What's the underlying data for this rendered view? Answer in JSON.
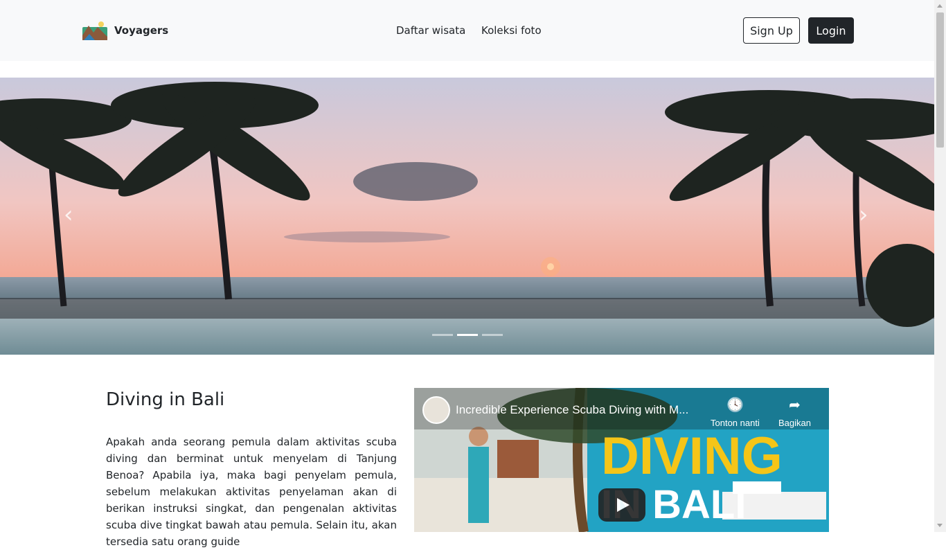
{
  "navbar": {
    "brand": "Voyagers",
    "links": [
      "Daftar wisata",
      "Koleksi foto"
    ],
    "signup_label": "Sign Up",
    "login_label": "Login"
  },
  "carousel": {
    "indicators": 3,
    "active_index": 1,
    "prev_icon": "chevron-left-icon",
    "next_icon": "chevron-right-icon"
  },
  "article": {
    "title": "Diving in Bali",
    "body": "Apakah anda seorang pemula dalam aktivitas scuba diving dan berminat untuk menyelam di Tanjung Benoa? Apabila iya, maka bagi penyelam pemula, sebelum melakukan aktivitas penyelaman akan di berikan instruksi singkat, dan pengenalan aktivitas scuba dive tingkat bawah atau pemula. Selain itu, akan tersedia satu orang guide"
  },
  "video": {
    "title": "Incredible Experience Scuba Diving with M...",
    "watch_later": "Tonton nanti",
    "share": "Bagikan",
    "thumb_line1": "DIVING",
    "thumb_line2": "IN BALI"
  },
  "colors": {
    "navbar_bg": "#f8f9fa",
    "text": "#212529",
    "thumb_yellow": "#f5c518"
  }
}
